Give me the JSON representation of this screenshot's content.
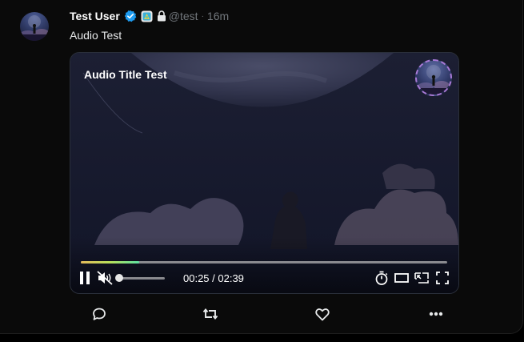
{
  "post": {
    "author_name": "Test User",
    "handle": "@test",
    "separator": "·",
    "time_ago": "16m",
    "text": "Audio Test"
  },
  "player": {
    "title": "Audio Title Test",
    "current_time": "00:25",
    "duration": "02:39",
    "time_display": "00:25 / 02:39",
    "progress_fraction": 0.16,
    "volume_fraction": 0.0,
    "muted": true,
    "playing": true,
    "progress_colors": [
      "#e3b95a",
      "#b8e05a",
      "#5de0a0"
    ],
    "cover_ring_color": "#a779d6"
  },
  "icons": {
    "verified": "verified-badge-icon",
    "app_badge": "app-badge-icon",
    "lock": "lock-icon",
    "pause": "pause-icon",
    "volume": "volume-muted-icon",
    "timer": "timer-icon",
    "theater": "theater-mode-icon",
    "pip": "picture-in-picture-icon",
    "fullscreen": "fullscreen-icon",
    "reply": "reply-icon",
    "repost": "repost-icon",
    "like": "like-icon",
    "more": "more-icon"
  },
  "colors": {
    "verified": "#1d9bf0",
    "muted_text": "#71767b",
    "background": "#0a0a0a"
  }
}
